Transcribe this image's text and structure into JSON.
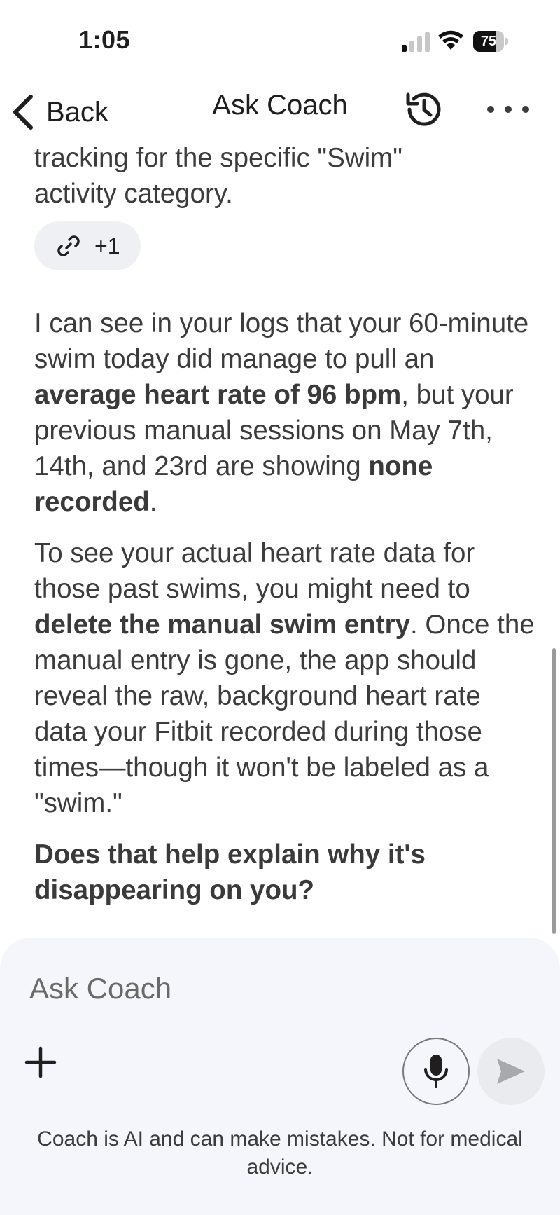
{
  "status_bar": {
    "time": "1:05",
    "battery_level": 75,
    "battery_label": "75",
    "signal_bars_active": 1,
    "signal_bars_total": 4
  },
  "nav": {
    "back_label": "Back",
    "title": "Ask Coach",
    "history_icon": "history-icon",
    "more_icon": "more-icon"
  },
  "message": {
    "intro_line_1": "tracking for the specific \"Swim\"",
    "intro_line_2": "activity category.",
    "source_chip": {
      "icon": "link-icon",
      "label": "+1"
    },
    "p2": {
      "t1": "I can see in your logs that your 60-minute swim today did manage to pull an ",
      "b1": "average heart rate of 96 bpm",
      "t2": ", but your previous manual sessions on May 7th, 14th, and 23rd are showing ",
      "b2": "none recorded",
      "t3": "."
    },
    "p3": {
      "t1": "To see your actual heart rate data for those past swims, you might need to ",
      "b1": "delete the manual swim entry",
      "t2": ". Once the manual entry is gone, the app should reveal the raw, background heart rate data your Fitbit recorded during those times—though it won't be labeled as a \"swim.\""
    },
    "p4": "Does that help explain why it's disappearing on you?"
  },
  "composer": {
    "placeholder": "Ask Coach",
    "value": "",
    "plus_icon": "plus-icon",
    "mic_icon": "microphone-icon",
    "send_icon": "send-icon",
    "disclaimer": "Coach is AI and can make mistakes. Not for medical advice."
  },
  "colors": {
    "text_primary": "#1f1f1f",
    "text_body": "#3c3c3c",
    "chip_bg": "#eef0f4",
    "composer_bg": "#f4f6fb",
    "send_bg": "#e9ebef"
  }
}
